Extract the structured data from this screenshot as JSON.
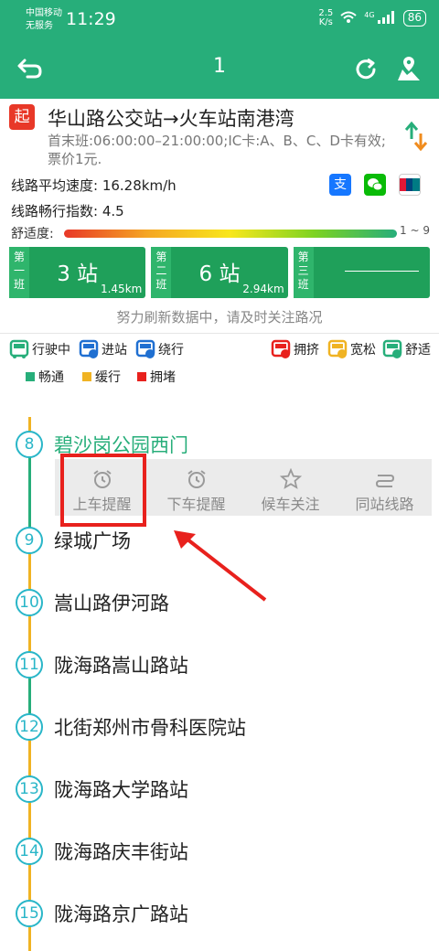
{
  "status_bar": {
    "carrier": "中国移动",
    "service": "无服务",
    "time": "11:29",
    "net_speed": "2.5",
    "net_unit": "K/s",
    "signal_label": "4G",
    "battery": "86"
  },
  "top_bar": {
    "title": "1"
  },
  "route": {
    "start_badge": "起",
    "name": "华山路公交站→火车站南港湾",
    "schedule": "首末班:06:00:00–21:00:00;IC卡:A、B、C、D卡有效;票价1元."
  },
  "info": {
    "avg_speed_label": "线路平均速度: 16.28km/h",
    "smooth_index_label": "线路畅行指数: 4.5",
    "comfort_label": "舒适度:",
    "comfort_scale": "1 ~ 9"
  },
  "buses": [
    {
      "tag_chars": [
        "第",
        "一",
        "班"
      ],
      "count": "3 站",
      "distance": "1.45km"
    },
    {
      "tag_chars": [
        "第",
        "二",
        "班"
      ],
      "count": "6 站",
      "distance": "2.94km"
    },
    {
      "tag_chars": [
        "第",
        "三",
        "班"
      ],
      "count": "",
      "distance": ""
    }
  ],
  "refresh_message": "努力刷新数据中，请及时关注路况",
  "legend": {
    "running": "行驶中",
    "entering": "进站",
    "detour": "绕行",
    "crowded": "拥挤",
    "loose": "宽松",
    "comfortable": "舒适"
  },
  "traffic": {
    "smooth": "畅通",
    "slow": "缓行",
    "jam": "拥堵",
    "colors": {
      "smooth": "#27ae7a",
      "slow": "#f0b323",
      "jam": "#e8211d"
    }
  },
  "stations": [
    {
      "num": "8",
      "name": "碧沙岗公园西门"
    },
    {
      "num": "9",
      "name": "绿城广场"
    },
    {
      "num": "10",
      "name": "嵩山路伊河路"
    },
    {
      "num": "11",
      "name": "陇海路嵩山路站"
    },
    {
      "num": "12",
      "name": "北街郑州市骨科医院站"
    },
    {
      "num": "13",
      "name": "陇海路大学路站"
    },
    {
      "num": "14",
      "name": "陇海路庆丰街站"
    },
    {
      "num": "15",
      "name": "陇海路京广路站"
    }
  ],
  "popup": {
    "board_reminder": "上车提醒",
    "alight_reminder": "下车提醒",
    "wait_follow": "候车关注",
    "same_stop_lines": "同站线路"
  },
  "accent_color": "#27ae7a"
}
